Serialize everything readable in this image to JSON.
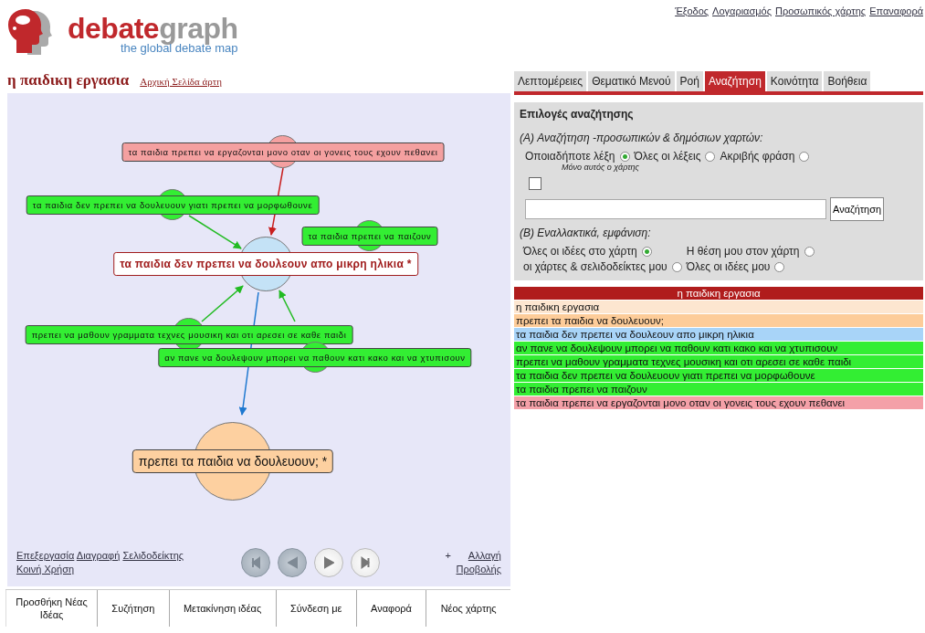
{
  "logo": {
    "word_1": "debate",
    "word_2": "graph",
    "tagline": "the global debate map"
  },
  "top_links": [
    "Έξοδος",
    "Λογαριασμός",
    "Προσωπικός χάρτης",
    "Επαναφορά"
  ],
  "map_title": "η παιδικη εργασια",
  "map_home_link": "Αρχική Σελίδα άρτη",
  "map": {
    "nodes": [
      {
        "text": "τα παιδια πρεπει να εργαζονται μονο οταν οι γονεις τους εχουν πεθανει",
        "kind": "child",
        "color": "#f4a0a0"
      },
      {
        "text": "τα παιδια δεν πρεπει να δουλευουν γιατι πρεπει να μορφωθουνε",
        "kind": "child",
        "color": "#33ee33"
      },
      {
        "text": "τα παιδια πρεπει να παιζουν",
        "kind": "child",
        "color": "#33ee33"
      },
      {
        "text": "τα παιδια δεν πρεπει να δουλεουν απο μικρη ηλικια *",
        "kind": "focus",
        "color": "#c4e2f6"
      },
      {
        "text": "πρεπει να μαθουν γραμματα τεχνες μουσικη και οτι αρεσει σε καθε παιδι",
        "kind": "child",
        "color": "#33ee33"
      },
      {
        "text": "αν πανε να δουλεψουν μπορει να παθουν κατι κακο και να χτυπισουν",
        "kind": "child",
        "color": "#33ee33"
      },
      {
        "text": "πρεπει τα παιδια να δουλευουν; *",
        "kind": "parent",
        "color": "#fdd0a0"
      }
    ],
    "actions": [
      "Επεξεργασία",
      "Διαγραφή",
      "Σελιδοδείκτης",
      "Κοινή Χρήση"
    ],
    "nav_buttons": [
      {
        "kind": "first",
        "disabled": true
      },
      {
        "kind": "prev",
        "disabled": true
      },
      {
        "kind": "next",
        "disabled": false
      },
      {
        "kind": "last",
        "disabled": false
      }
    ],
    "view_change": {
      "prefix": "+",
      "link": "Αλλαγή Προβολής"
    }
  },
  "toolbar": [
    "Προσθήκη Νέας Ιδέας",
    "Συζήτηση",
    "Μετακίνηση ιδέας",
    "Σύνδεση με",
    "Αναφορά",
    "Νέος χάρτης"
  ],
  "tabs": [
    {
      "label": "Λεπτομέρειες",
      "selected": false
    },
    {
      "label": "Θεματικό Μενού",
      "selected": false
    },
    {
      "label": "Ροή",
      "selected": false
    },
    {
      "label": "Αναζήτηση",
      "selected": true
    },
    {
      "label": "Κοινότητα",
      "selected": false
    },
    {
      "label": "Βοήθεια",
      "selected": false
    }
  ],
  "search": {
    "title": "Επιλογές αναζήτησης",
    "section_a": "(A) Αναζήτηση -προσωπικών & δημόσιων χαρτών:",
    "match_options": [
      {
        "label": "Οποιαδήποτε λέξη",
        "selected": true
      },
      {
        "label": "Όλες οι λέξεις",
        "selected": false
      },
      {
        "label": "Ακριβής φράση",
        "selected": false
      }
    ],
    "only_this_map": {
      "label": "Μόνο αυτός ο χάρτης",
      "checked": false
    },
    "button": "Αναζήτηση",
    "section_b": "(B) Εναλλακτικά, εμφάνιση:",
    "view_options": [
      {
        "label": "Όλες οι ιδέες στο χάρτη",
        "selected": true
      },
      {
        "label": "Η θέση μου στον χάρτη",
        "selected": false
      },
      {
        "label": "οι χάρτες & σελιδοδείκτες μου",
        "selected": false
      },
      {
        "label": "Όλες οι ιδέες μου",
        "selected": false
      }
    ]
  },
  "idea_list": {
    "header": "η παιδικη εργασια",
    "items": [
      {
        "text": "η παιδικη εργασια",
        "color": "#fde6d0"
      },
      {
        "text": "πρεπει τα παιδια να δουλευουν;",
        "color": "#fdcc99"
      },
      {
        "text": "τα παιδια δεν πρεπει να δουλεουν απο μικρη ηλικια",
        "color": "#a8d4f8"
      },
      {
        "text": "αν πανε να δουλεψουν μπορει να παθουν κατι κακο και να χτυπισουν",
        "color": "#33ee33"
      },
      {
        "text": "πρεπει να μαθουν γραμματα τεχνες μουσικη και οτι αρεσει σε καθε παιδι",
        "color": "#33ee33"
      },
      {
        "text": "τα παιδια δεν πρεπει να δουλευουν γιατι πρεπει να μορφωθουνε",
        "color": "#33ee33"
      },
      {
        "text": "τα παιδια πρεπει να παιζουν",
        "color": "#33ee33"
      },
      {
        "text": "τα παιδια πρεπει να εργαζονται μονο οταν οι γονεις τους εχουν πεθανει",
        "color": "#f4a0a8"
      }
    ]
  }
}
